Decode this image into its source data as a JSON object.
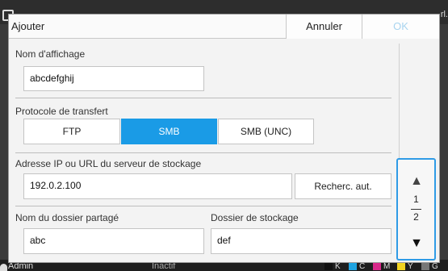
{
  "background": {
    "top_right_text": "rl.",
    "user": "Admin",
    "status": "Inactif",
    "inks": [
      {
        "label": "K",
        "color": "#111111"
      },
      {
        "label": "C",
        "color": "#1fa3e0"
      },
      {
        "label": "M",
        "color": "#d8288a"
      },
      {
        "label": "Y",
        "color": "#f2d321"
      },
      {
        "label": "G",
        "color": "#777777"
      }
    ]
  },
  "dialog": {
    "title": "Ajouter",
    "cancel_label": "Annuler",
    "ok_label": "OK",
    "display_name": {
      "label": "Nom d'affichage",
      "value": "abcdefghij"
    },
    "protocol": {
      "label": "Protocole de transfert",
      "options": [
        "FTP",
        "SMB",
        "SMB (UNC)"
      ],
      "selected": "SMB"
    },
    "server": {
      "label": "Adresse IP ou URL du serveur de stockage",
      "value": "192.0.2.100",
      "search_label": "Recherc. aut."
    },
    "shared_folder": {
      "label": "Nom du dossier partagé",
      "value": "abc"
    },
    "storage_folder": {
      "label": "Dossier de stockage",
      "value": "def"
    }
  },
  "pager": {
    "current": "1",
    "total": "2",
    "up_icon": "triangle-up",
    "down_icon": "triangle-down"
  },
  "colors": {
    "accent": "#1a9be6",
    "ok_disabled": "#a8d4ef"
  }
}
